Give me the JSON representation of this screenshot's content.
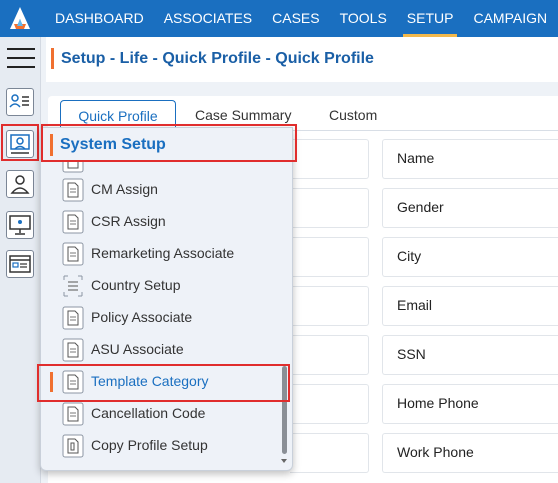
{
  "nav": {
    "items": [
      {
        "label": "DASHBOARD"
      },
      {
        "label": "ASSOCIATES"
      },
      {
        "label": "CASES"
      },
      {
        "label": "TOOLS"
      },
      {
        "label": "SETUP",
        "active": true
      },
      {
        "label": "CAMPAIGN"
      }
    ]
  },
  "header": {
    "breadcrumb": "Setup - Life - Quick Profile - Quick Profile"
  },
  "tabs": [
    {
      "label": "Quick Profile",
      "active": true
    },
    {
      "label": "Case Summary"
    },
    {
      "label": "Custom"
    }
  ],
  "form": {
    "fields": [
      {
        "label": "Name"
      },
      {
        "label": "Gender"
      },
      {
        "label": "City"
      },
      {
        "label": "Email"
      },
      {
        "label": "SSN"
      },
      {
        "label": "Home Phone"
      },
      {
        "label": "Work Phone"
      }
    ]
  },
  "dropdown": {
    "title": "System Setup",
    "items": [
      {
        "label": "CM Assign",
        "icon": "document-icon"
      },
      {
        "label": "CSR Assign",
        "icon": "document-icon"
      },
      {
        "label": "Remarketing Associate",
        "icon": "document-icon"
      },
      {
        "label": "Country Setup",
        "icon": "list-icon"
      },
      {
        "label": "Policy Associate",
        "icon": "document-icon"
      },
      {
        "label": "ASU Associate",
        "icon": "document-icon"
      },
      {
        "label": "Template Category",
        "icon": "document-icon",
        "selected": true
      },
      {
        "label": "Cancellation Code",
        "icon": "document-icon"
      },
      {
        "label": "Copy Profile Setup",
        "icon": "copy-document-icon"
      }
    ]
  },
  "colors": {
    "nav_bg": "#1a6fc0",
    "accent": "#f07030",
    "highlight": "#e02d2d",
    "link": "#1a6fc0"
  }
}
